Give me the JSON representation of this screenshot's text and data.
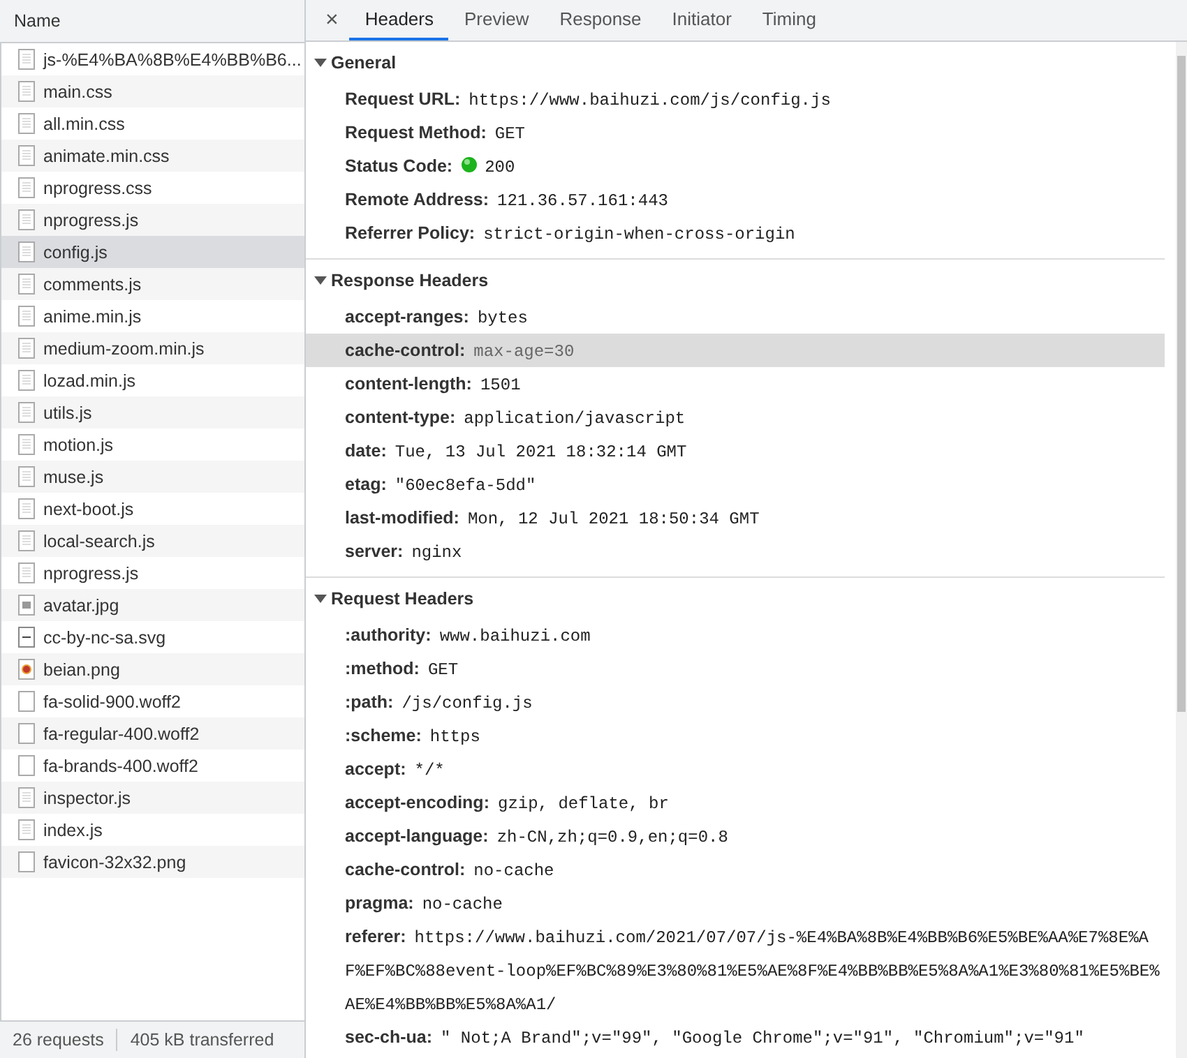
{
  "request_list": {
    "column": "Name",
    "items": [
      {
        "name": "js-%E4%BA%8B%E4%BB%B6...",
        "kind": "doc",
        "selected": false
      },
      {
        "name": "main.css",
        "kind": "doc",
        "selected": false
      },
      {
        "name": "all.min.css",
        "kind": "doc",
        "selected": false
      },
      {
        "name": "animate.min.css",
        "kind": "doc",
        "selected": false
      },
      {
        "name": "nprogress.css",
        "kind": "doc",
        "selected": false
      },
      {
        "name": "nprogress.js",
        "kind": "doc",
        "selected": false
      },
      {
        "name": "config.js",
        "kind": "doc",
        "selected": true
      },
      {
        "name": "comments.js",
        "kind": "doc",
        "selected": false
      },
      {
        "name": "anime.min.js",
        "kind": "doc",
        "selected": false
      },
      {
        "name": "medium-zoom.min.js",
        "kind": "doc",
        "selected": false
      },
      {
        "name": "lozad.min.js",
        "kind": "doc",
        "selected": false
      },
      {
        "name": "utils.js",
        "kind": "doc",
        "selected": false
      },
      {
        "name": "motion.js",
        "kind": "doc",
        "selected": false
      },
      {
        "name": "muse.js",
        "kind": "doc",
        "selected": false
      },
      {
        "name": "next-boot.js",
        "kind": "doc",
        "selected": false
      },
      {
        "name": "local-search.js",
        "kind": "doc",
        "selected": false
      },
      {
        "name": "nprogress.js",
        "kind": "doc",
        "selected": false
      },
      {
        "name": "avatar.jpg",
        "kind": "image",
        "selected": false
      },
      {
        "name": "cc-by-nc-sa.svg",
        "kind": "svg",
        "selected": false
      },
      {
        "name": "beian.png",
        "kind": "badge",
        "selected": false
      },
      {
        "name": "fa-solid-900.woff2",
        "kind": "blank",
        "selected": false
      },
      {
        "name": "fa-regular-400.woff2",
        "kind": "blank",
        "selected": false
      },
      {
        "name": "fa-brands-400.woff2",
        "kind": "blank",
        "selected": false
      },
      {
        "name": "inspector.js",
        "kind": "doc",
        "selected": false
      },
      {
        "name": "index.js",
        "kind": "doc",
        "selected": false
      },
      {
        "name": "favicon-32x32.png",
        "kind": "blank",
        "selected": false
      }
    ],
    "status_bar": {
      "requests": "26 requests",
      "transferred": "405 kB transferred"
    }
  },
  "detail": {
    "close": "×",
    "tabs": [
      {
        "label": "Headers",
        "selected": true
      },
      {
        "label": "Preview",
        "selected": false
      },
      {
        "label": "Response",
        "selected": false
      },
      {
        "label": "Initiator",
        "selected": false
      },
      {
        "label": "Timing",
        "selected": false
      }
    ],
    "sections": [
      {
        "title": "General",
        "expanded": true,
        "rows": [
          {
            "key": "Request URL:",
            "value": "https://www.baihuzi.com/js/config.js",
            "kind": "plain",
            "highlighted": false
          },
          {
            "key": "Request Method:",
            "value": "GET",
            "kind": "plain",
            "highlighted": false
          },
          {
            "key": "Status Code:",
            "value": "200",
            "kind": "status",
            "highlighted": false
          },
          {
            "key": "Remote Address:",
            "value": "121.36.57.161:443",
            "kind": "plain",
            "highlighted": false
          },
          {
            "key": "Referrer Policy:",
            "value": "strict-origin-when-cross-origin",
            "kind": "plain",
            "highlighted": false
          }
        ]
      },
      {
        "title": "Response Headers",
        "expanded": true,
        "rows": [
          {
            "key": "accept-ranges:",
            "value": "bytes",
            "kind": "plain",
            "highlighted": false
          },
          {
            "key": "cache-control:",
            "value": "max-age=30",
            "kind": "plain",
            "highlighted": true
          },
          {
            "key": "content-length:",
            "value": "1501",
            "kind": "plain",
            "highlighted": false
          },
          {
            "key": "content-type:",
            "value": "application/javascript",
            "kind": "plain",
            "highlighted": false
          },
          {
            "key": "date:",
            "value": "Tue, 13 Jul 2021 18:32:14 GMT",
            "kind": "plain",
            "highlighted": false
          },
          {
            "key": "etag:",
            "value": "\"60ec8efa-5dd\"",
            "kind": "plain",
            "highlighted": false
          },
          {
            "key": "last-modified:",
            "value": "Mon, 12 Jul 2021 18:50:34 GMT",
            "kind": "plain",
            "highlighted": false
          },
          {
            "key": "server:",
            "value": "nginx",
            "kind": "plain",
            "highlighted": false
          }
        ]
      },
      {
        "title": "Request Headers",
        "expanded": true,
        "rows": [
          {
            "key": ":authority:",
            "value": "www.baihuzi.com",
            "kind": "plain",
            "highlighted": false
          },
          {
            "key": ":method:",
            "value": "GET",
            "kind": "plain",
            "highlighted": false
          },
          {
            "key": ":path:",
            "value": "/js/config.js",
            "kind": "plain",
            "highlighted": false
          },
          {
            "key": ":scheme:",
            "value": "https",
            "kind": "plain",
            "highlighted": false
          },
          {
            "key": "accept:",
            "value": "*/*",
            "kind": "plain",
            "highlighted": false
          },
          {
            "key": "accept-encoding:",
            "value": "gzip, deflate, br",
            "kind": "plain",
            "highlighted": false
          },
          {
            "key": "accept-language:",
            "value": "zh-CN,zh;q=0.9,en;q=0.8",
            "kind": "plain",
            "highlighted": false
          },
          {
            "key": "cache-control:",
            "value": "no-cache",
            "kind": "plain",
            "highlighted": false
          },
          {
            "key": "pragma:",
            "value": "no-cache",
            "kind": "plain",
            "highlighted": false
          },
          {
            "key": "referer:",
            "value": "https://www.baihuzi.com/2021/07/07/js-%E4%BA%8B%E4%BB%B6%E5%BE%AA%E7%8E%AF%EF%BC%88event-loop%EF%BC%89%E3%80%81%E5%AE%8F%E4%BB%BB%E5%8A%A1%E3%80%81%E5%BE%AE%E4%BB%BB%E5%8A%A1/",
            "kind": "plain",
            "highlighted": false
          },
          {
            "key": "sec-ch-ua:",
            "value": "\" Not;A Brand\";v=\"99\", \"Google Chrome\";v=\"91\", \"Chromium\";v=\"91\"",
            "kind": "plain",
            "highlighted": false
          }
        ]
      }
    ]
  }
}
